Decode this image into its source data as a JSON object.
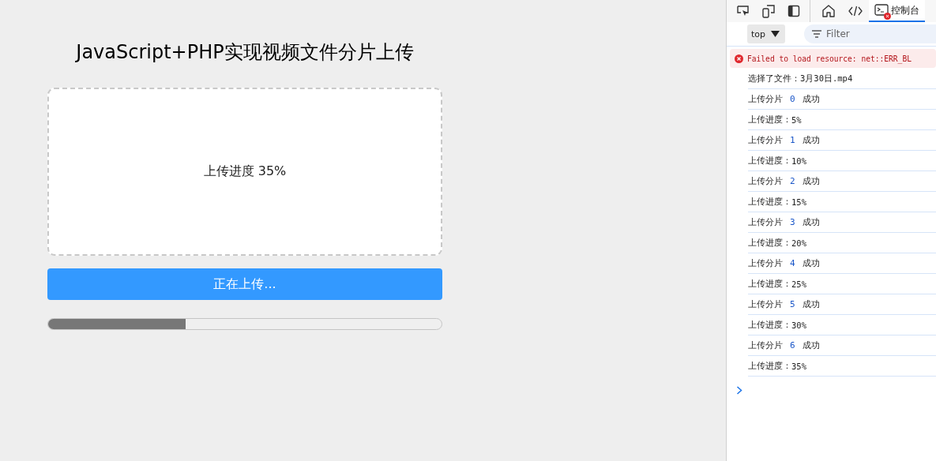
{
  "page": {
    "title": "JavaScript+PHP实现视频文件分片上传",
    "drop_zone": {
      "text": "上传进度 35%"
    },
    "upload_button": {
      "label": "正在上传...",
      "disabled": true
    },
    "progress": {
      "level": 0.35
    }
  },
  "devtools": {
    "tabs": [
      {
        "kind": "inspect",
        "selected": false
      },
      {
        "kind": "device",
        "selected": false
      },
      {
        "kind": "sidebar",
        "selected": false
      },
      {
        "kind": "home",
        "selected": false
      },
      {
        "kind": "code",
        "selected": false
      },
      {
        "kind": "console",
        "label": "控制台",
        "selected": true,
        "error_badge": true
      }
    ],
    "context": "top",
    "filter": {
      "placeholder": "Filter"
    },
    "messages": [
      {
        "kind": "error",
        "text": "Failed to load resource: net::ERR_BL"
      },
      {
        "kind": "log",
        "label": "选择了文件：",
        "value": "3月30日.mp4"
      },
      {
        "kind": "chunk",
        "label": "上传分片",
        "index": "0",
        "status": "成功"
      },
      {
        "kind": "log",
        "label": "上传进度：",
        "value": "5%"
      },
      {
        "kind": "chunk",
        "label": "上传分片",
        "index": "1",
        "status": "成功"
      },
      {
        "kind": "log",
        "label": "上传进度：",
        "value": "10%"
      },
      {
        "kind": "chunk",
        "label": "上传分片",
        "index": "2",
        "status": "成功"
      },
      {
        "kind": "log",
        "label": "上传进度：",
        "value": "15%"
      },
      {
        "kind": "chunk",
        "label": "上传分片",
        "index": "3",
        "status": "成功"
      },
      {
        "kind": "log",
        "label": "上传进度：",
        "value": "20%"
      },
      {
        "kind": "chunk",
        "label": "上传分片",
        "index": "4",
        "status": "成功"
      },
      {
        "kind": "log",
        "label": "上传进度：",
        "value": "25%"
      },
      {
        "kind": "chunk",
        "label": "上传分片",
        "index": "5",
        "status": "成功"
      },
      {
        "kind": "log",
        "label": "上传进度：",
        "value": "30%"
      },
      {
        "kind": "chunk",
        "label": "上传分片",
        "index": "6",
        "status": "成功"
      },
      {
        "kind": "log",
        "label": "上传进度：",
        "value": "35%"
      }
    ]
  }
}
